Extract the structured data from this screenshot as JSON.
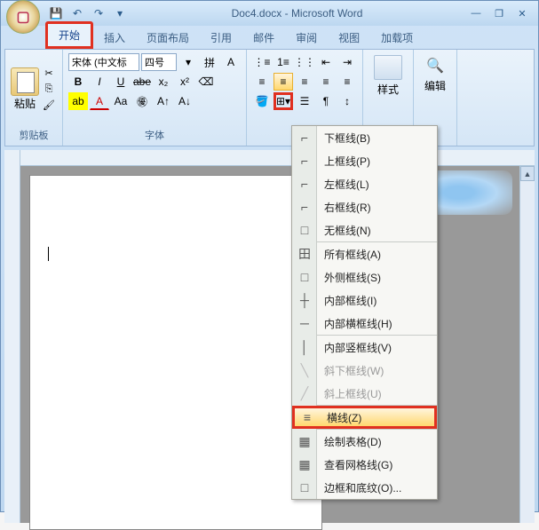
{
  "titlebar": {
    "title": "Doc4.docx - Microsoft Word"
  },
  "qat": {
    "save": "💾",
    "undo": "↶",
    "redo": "↷",
    "more": "▾"
  },
  "win": {
    "min": "—",
    "max": "❐",
    "close": "✕",
    "help": "?"
  },
  "tabs": {
    "home": "开始",
    "insert": "插入",
    "layout": "页面布局",
    "references": "引用",
    "mail": "邮件",
    "review": "审阅",
    "view": "视图",
    "addins": "加载项"
  },
  "groups": {
    "clipboard": {
      "label": "剪贴板",
      "paste": "粘贴"
    },
    "font": {
      "label": "字体",
      "font_name": "宋体 (中文标",
      "font_size": "四号"
    },
    "styles": {
      "label": "样式"
    },
    "editing": {
      "label": "编辑"
    }
  },
  "border_menu": {
    "items": [
      {
        "icon": "⌐",
        "label": "下框线(B)",
        "key": "B"
      },
      {
        "icon": "⌐",
        "label": "上框线(P)",
        "key": "P"
      },
      {
        "icon": "⌐",
        "label": "左框线(L)",
        "key": "L"
      },
      {
        "icon": "⌐",
        "label": "右框线(R)",
        "key": "R"
      },
      {
        "icon": "□",
        "label": "无框线(N)",
        "key": "N",
        "sep_after": true
      },
      {
        "icon": "田",
        "label": "所有框线(A)",
        "key": "A"
      },
      {
        "icon": "□",
        "label": "外侧框线(S)",
        "key": "S"
      },
      {
        "icon": "┼",
        "label": "内部框线(I)",
        "key": "I"
      },
      {
        "icon": "─",
        "label": "内部横框线(H)",
        "key": "H",
        "sep_after": true
      },
      {
        "icon": "│",
        "label": "内部竖框线(V)",
        "key": "V"
      },
      {
        "icon": "╲",
        "label": "斜下框线(W)",
        "key": "W",
        "disabled": true
      },
      {
        "icon": "╱",
        "label": "斜上框线(U)",
        "key": "U",
        "disabled": true,
        "sep_after": true
      },
      {
        "icon": "≡",
        "label": "横线(Z)",
        "key": "Z",
        "highlighted": true,
        "sep_after": true
      },
      {
        "icon": "▦",
        "label": "绘制表格(D)",
        "key": "D"
      },
      {
        "icon": "▦",
        "label": "查看网格线(G)",
        "key": "G"
      },
      {
        "icon": "□",
        "label": "边框和底纹(O)...",
        "key": "O"
      }
    ]
  }
}
